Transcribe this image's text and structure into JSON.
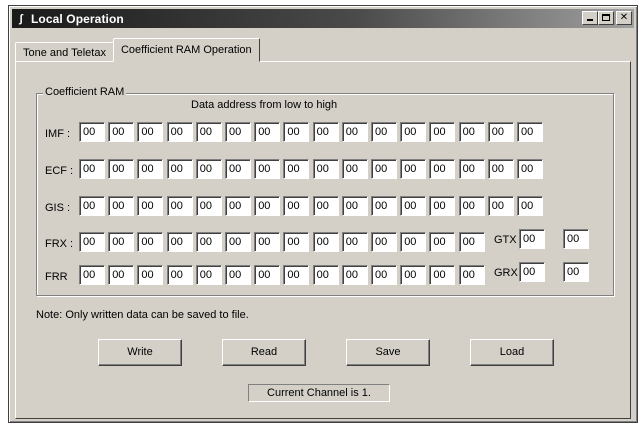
{
  "window": {
    "title": "Local Operation",
    "icon": "app-icon",
    "controls": [
      "minimize",
      "maximize",
      "close"
    ]
  },
  "tabs": [
    {
      "label": "Tone and Teletax",
      "active": false
    },
    {
      "label": "Coefficient RAM Operation",
      "active": true
    }
  ],
  "group": {
    "title": "Coefficient RAM",
    "hint": "Data address from low to high"
  },
  "rows": [
    {
      "label": "IMF :",
      "values": [
        "00",
        "00",
        "00",
        "00",
        "00",
        "00",
        "00",
        "00",
        "00",
        "00",
        "00",
        "00",
        "00",
        "00",
        "00",
        "00"
      ]
    },
    {
      "label": "ECF :",
      "values": [
        "00",
        "00",
        "00",
        "00",
        "00",
        "00",
        "00",
        "00",
        "00",
        "00",
        "00",
        "00",
        "00",
        "00",
        "00",
        "00"
      ]
    },
    {
      "label": "GIS :",
      "values": [
        "00",
        "00",
        "00",
        "00",
        "00",
        "00",
        "00",
        "00",
        "00",
        "00",
        "00",
        "00",
        "00",
        "00",
        "00",
        "00"
      ]
    },
    {
      "label": "FRX :",
      "values": [
        "00",
        "00",
        "00",
        "00",
        "00",
        "00",
        "00",
        "00",
        "00",
        "00",
        "00",
        "00",
        "00",
        "00"
      ],
      "extra_label": "GTX",
      "extra_values": [
        "00",
        "00"
      ]
    },
    {
      "label": "FRR",
      "values": [
        "00",
        "00",
        "00",
        "00",
        "00",
        "00",
        "00",
        "00",
        "00",
        "00",
        "00",
        "00",
        "00",
        "00"
      ],
      "extra_label": "GRX",
      "extra_values": [
        "00",
        "00"
      ]
    }
  ],
  "note": "Note: Only written data can be saved to file.",
  "buttons": {
    "write": "Write",
    "read": "Read",
    "save": "Save",
    "load": "Load"
  },
  "status": "Current Channel is 1."
}
